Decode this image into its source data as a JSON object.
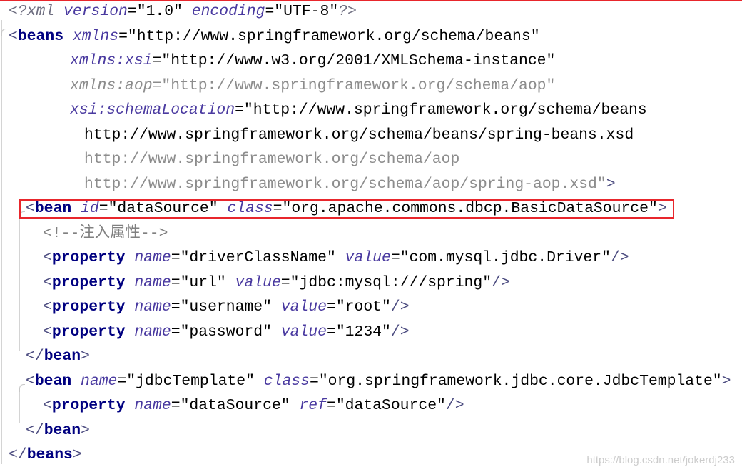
{
  "editor": {
    "syntax_colors": {
      "declaration": "#6e6e80",
      "bracket": "#4c4c80",
      "tag": "#000080",
      "attribute": "#4a3aa0",
      "text": "#000000",
      "value": "#000000",
      "unused": "#8c8c8c",
      "comment": "#808080",
      "annotation": "#e8262c"
    },
    "lines": [
      {
        "tokens": [
          {
            "type": "pi",
            "text": "<?xml"
          },
          {
            "type": "attr",
            "text": " version"
          },
          {
            "type": "eq",
            "text": "="
          },
          {
            "type": "val",
            "text": "\"1.0\""
          },
          {
            "type": "attr",
            "text": " encoding"
          },
          {
            "type": "eq",
            "text": "="
          },
          {
            "type": "val",
            "text": "\"UTF-8\""
          },
          {
            "type": "pi",
            "text": "?>"
          }
        ]
      },
      {
        "tokens": [
          {
            "type": "br",
            "text": "<"
          },
          {
            "type": "tag",
            "text": "beans"
          },
          {
            "type": "attr",
            "text": " xmlns"
          },
          {
            "type": "eq",
            "text": "="
          },
          {
            "type": "val",
            "text": "\"http://www.springframework.org/schema/beans\""
          }
        ]
      },
      {
        "tokens": [
          {
            "type": "attr",
            "text": "xmlns:xsi"
          },
          {
            "type": "eq",
            "text": "="
          },
          {
            "type": "val",
            "text": "\"http://www.w3.org/2001/XMLSchema-instance\""
          }
        ]
      },
      {
        "tokens": [
          {
            "type": "mattr",
            "text": "xmlns:aop"
          },
          {
            "type": "muted",
            "text": "=\"http://www.springframework.org/schema/aop\""
          }
        ]
      },
      {
        "tokens": [
          {
            "type": "attr",
            "text": "xsi:schemaLocation"
          },
          {
            "type": "eq",
            "text": "="
          },
          {
            "type": "val",
            "text": "\"http://www.springframework.org/schema/beans"
          }
        ]
      },
      {
        "tokens": [
          {
            "type": "val",
            "text": "http://www.springframework.org/schema/beans/spring-beans.xsd"
          }
        ]
      },
      {
        "tokens": [
          {
            "type": "muted",
            "text": "http://www.springframework.org/schema/aop"
          }
        ]
      },
      {
        "tokens": [
          {
            "type": "muted",
            "text": "http://www.springframework.org/schema/aop/spring-aop.xsd\""
          },
          {
            "type": "br",
            "text": ">"
          }
        ]
      },
      {
        "tokens": [
          {
            "type": "br",
            "text": "<"
          },
          {
            "type": "tag",
            "text": "bean"
          },
          {
            "type": "attr",
            "text": " id"
          },
          {
            "type": "eq",
            "text": "="
          },
          {
            "type": "val",
            "text": "\"dataSource\""
          },
          {
            "type": "attr",
            "text": " class"
          },
          {
            "type": "eq",
            "text": "="
          },
          {
            "type": "val",
            "text": "\"org.apache.commons.dbcp.BasicDataSource\""
          },
          {
            "type": "br",
            "text": ">"
          }
        ]
      },
      {
        "tokens": [
          {
            "type": "comment",
            "text": "<!--注入属性-->"
          }
        ]
      },
      {
        "tokens": [
          {
            "type": "br",
            "text": "<"
          },
          {
            "type": "tag",
            "text": "property"
          },
          {
            "type": "attr",
            "text": " name"
          },
          {
            "type": "eq",
            "text": "="
          },
          {
            "type": "val",
            "text": "\"driverClassName\""
          },
          {
            "type": "attr",
            "text": " value"
          },
          {
            "type": "eq",
            "text": "="
          },
          {
            "type": "val",
            "text": "\"com.mysql.jdbc.Driver\""
          },
          {
            "type": "br",
            "text": "/>"
          }
        ]
      },
      {
        "tokens": [
          {
            "type": "br",
            "text": "<"
          },
          {
            "type": "tag",
            "text": "property"
          },
          {
            "type": "attr",
            "text": " name"
          },
          {
            "type": "eq",
            "text": "="
          },
          {
            "type": "val",
            "text": "\"url\""
          },
          {
            "type": "attr",
            "text": " value"
          },
          {
            "type": "eq",
            "text": "="
          },
          {
            "type": "val",
            "text": "\"jdbc:mysql:///spring\""
          },
          {
            "type": "br",
            "text": "/>"
          }
        ]
      },
      {
        "tokens": [
          {
            "type": "br",
            "text": "<"
          },
          {
            "type": "tag",
            "text": "property"
          },
          {
            "type": "attr",
            "text": " name"
          },
          {
            "type": "eq",
            "text": "="
          },
          {
            "type": "val",
            "text": "\"username\""
          },
          {
            "type": "attr",
            "text": " value"
          },
          {
            "type": "eq",
            "text": "="
          },
          {
            "type": "val",
            "text": "\"root\""
          },
          {
            "type": "br",
            "text": "/>"
          }
        ]
      },
      {
        "tokens": [
          {
            "type": "br",
            "text": "<"
          },
          {
            "type": "tag",
            "text": "property"
          },
          {
            "type": "attr",
            "text": " name"
          },
          {
            "type": "eq",
            "text": "="
          },
          {
            "type": "val",
            "text": "\"password\""
          },
          {
            "type": "attr",
            "text": " value"
          },
          {
            "type": "eq",
            "text": "="
          },
          {
            "type": "val",
            "text": "\"1234\""
          },
          {
            "type": "br",
            "text": "/>"
          }
        ]
      },
      {
        "tokens": [
          {
            "type": "br",
            "text": "</"
          },
          {
            "type": "tag",
            "text": "bean"
          },
          {
            "type": "br",
            "text": ">"
          }
        ]
      },
      {
        "tokens": [
          {
            "type": "br",
            "text": "<"
          },
          {
            "type": "tag",
            "text": "bean"
          },
          {
            "type": "attr",
            "text": " name"
          },
          {
            "type": "eq",
            "text": "="
          },
          {
            "type": "val",
            "text": "\"jdbcTemplate\""
          },
          {
            "type": "attr",
            "text": " class"
          },
          {
            "type": "eq",
            "text": "="
          },
          {
            "type": "val",
            "text": "\"org.springframework.jdbc.core.JdbcTemplate\""
          },
          {
            "type": "br",
            "text": ">"
          }
        ]
      },
      {
        "tokens": [
          {
            "type": "br",
            "text": "<"
          },
          {
            "type": "tag",
            "text": "property"
          },
          {
            "type": "attr",
            "text": " name"
          },
          {
            "type": "eq",
            "text": "="
          },
          {
            "type": "val",
            "text": "\"dataSource\""
          },
          {
            "type": "attr",
            "text": " ref"
          },
          {
            "type": "eq",
            "text": "="
          },
          {
            "type": "val",
            "text": "\"dataSource\""
          },
          {
            "type": "br",
            "text": "/>"
          }
        ]
      },
      {
        "tokens": [
          {
            "type": "br",
            "text": "</"
          },
          {
            "type": "tag",
            "text": "bean"
          },
          {
            "type": "br",
            "text": ">"
          }
        ]
      },
      {
        "tokens": [
          {
            "type": "br",
            "text": "</"
          },
          {
            "type": "tag",
            "text": "beans"
          },
          {
            "type": "br",
            "text": ">"
          }
        ]
      }
    ]
  },
  "watermark": "https://blog.csdn.net/jokerdj233"
}
